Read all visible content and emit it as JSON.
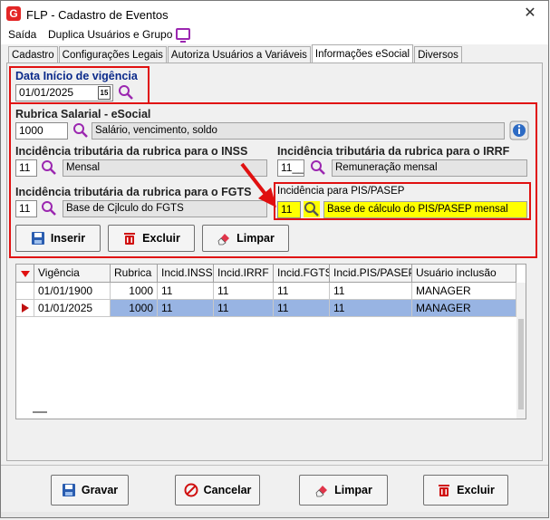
{
  "window": {
    "title": "FLP - Cadastro de Eventos",
    "close": "✕"
  },
  "menu": {
    "saida": "Saída",
    "duplica": "Duplica Usuários e Grupo"
  },
  "tabs": [
    {
      "label": "Cadastro"
    },
    {
      "label": "Configurações Legais"
    },
    {
      "label": "Autoriza Usuários a Variáveis"
    },
    {
      "label": "Informações eSocial"
    },
    {
      "label": "Diversos"
    }
  ],
  "vigencia": {
    "label": "Data Início de vigência",
    "value": "01/01/2025",
    "cal": "15"
  },
  "rubrica": {
    "label": "Rubrica Salarial - eSocial",
    "code": "1000",
    "desc": "Salário, vencimento, soldo"
  },
  "inss": {
    "label": "Incidência tributária da rubrica para o INSS",
    "code": "11",
    "desc": "Mensal"
  },
  "irrf": {
    "label": "Incidência tributária da rubrica para o IRRF",
    "code": "11__",
    "desc": "Remuneração mensal"
  },
  "fgts": {
    "label": "Incidência tributária da rubrica para o FGTS",
    "code": "11",
    "desc": "Base de Cįlculo do FGTS"
  },
  "pis": {
    "label": "Incidência para PIS/PASEP",
    "code": "11",
    "desc": "Base de cálculo do PIS/PASEP mensal"
  },
  "actions": {
    "inserir": "Inserir",
    "excluir": "Excluir",
    "limpar": "Limpar"
  },
  "grid": {
    "headers": [
      "Vigência",
      "Rubrica",
      "Incid.INSS",
      "Incid.IRRF",
      "Incid.FGTS",
      "Incid.PIS/PASEP",
      "Usuário inclusão"
    ],
    "rows": [
      [
        "01/01/1900",
        "1000",
        "11",
        "11",
        "11",
        "11",
        "MANAGER"
      ],
      [
        "01/01/2025",
        "1000",
        "11",
        "11",
        "11",
        "11",
        "MANAGER"
      ]
    ]
  },
  "footer": {
    "gravar": "Gravar",
    "cancelar": "Cancelar",
    "limpar": "Limpar",
    "excluir": "Excluir"
  },
  "colors": {
    "highlight_red": "#e01010",
    "selection": "#98b4e3",
    "pis_highlight": "#ffff00",
    "search_icon": "#9b27b0"
  }
}
